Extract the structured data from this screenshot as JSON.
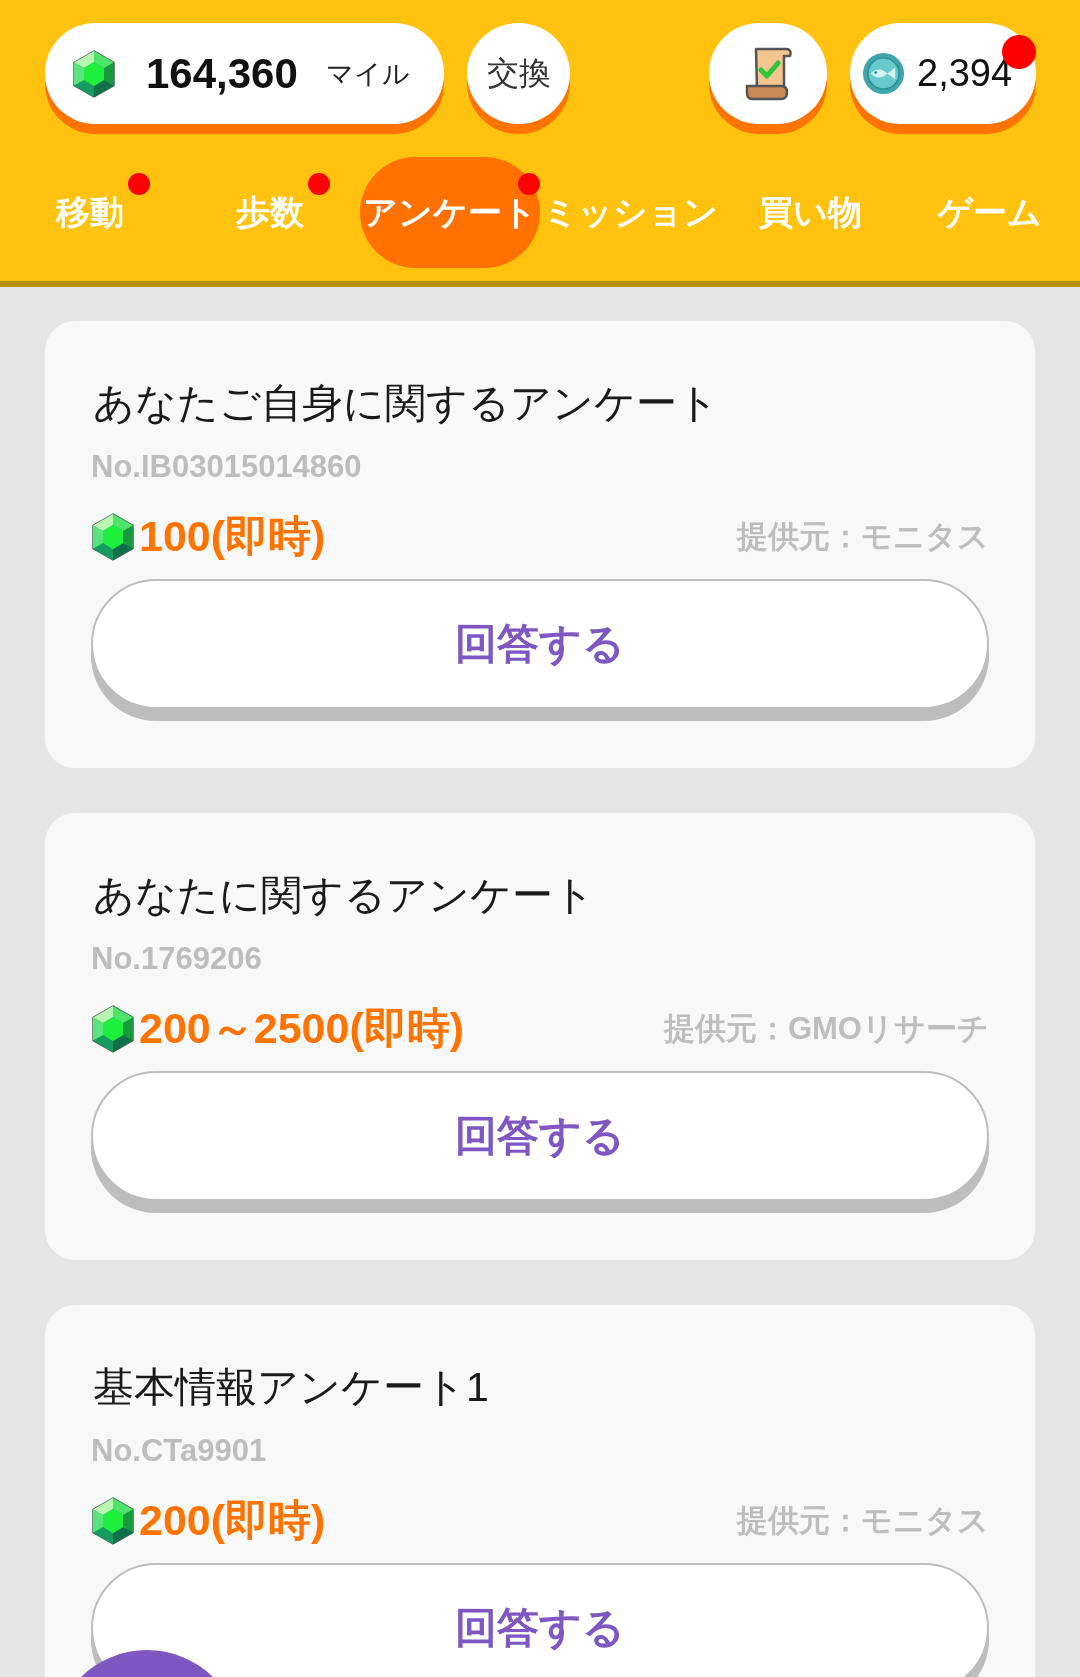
{
  "header": {
    "miles": {
      "value": "164,360",
      "unit": "マイル"
    },
    "exchange_button": "交換",
    "coins": {
      "value": "2,394",
      "badge": true
    }
  },
  "tabs": [
    {
      "label": "移動",
      "selected": false,
      "badge": true
    },
    {
      "label": "歩数",
      "selected": false,
      "badge": true
    },
    {
      "label": "アンケート",
      "selected": true,
      "badge": true
    },
    {
      "label": "ミッション",
      "selected": false,
      "badge": false
    },
    {
      "label": "買い物",
      "selected": false,
      "badge": false
    },
    {
      "label": "ゲーム",
      "selected": false,
      "badge": false
    }
  ],
  "surveys": [
    {
      "title": "あなたご自身に関するアンケート",
      "number": "No.IB03015014860",
      "reward": "100(即時)",
      "provider": "提供元：モニタス",
      "button": "回答する"
    },
    {
      "title": "あなたに関するアンケート",
      "number": "No.1769206",
      "reward": "200～2500(即時)",
      "provider": "提供元：GMOリサーチ",
      "button": "回答する"
    },
    {
      "title": "基本情報アンケート1",
      "number": "No.CTa9901",
      "reward": "200(即時)",
      "provider": "提供元：モニタス",
      "button": "回答する"
    }
  ]
}
